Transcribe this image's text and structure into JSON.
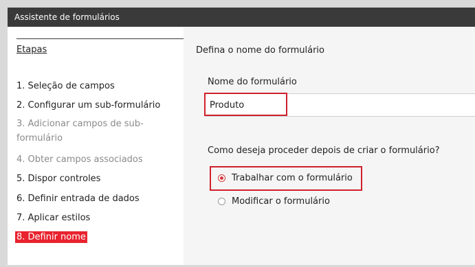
{
  "window": {
    "title": "Assistente de formulários"
  },
  "steps": {
    "heading": "Etapas",
    "items": [
      {
        "label": "1. Seleção de campos",
        "state": "normal"
      },
      {
        "label": "2. Configurar um sub-formulário",
        "state": "normal"
      },
      {
        "label": "3. Adicionar campos de sub-formulário",
        "state": "disabled"
      },
      {
        "label": "4. Obter campos associados",
        "state": "disabled"
      },
      {
        "label": "5. Dispor controles",
        "state": "normal"
      },
      {
        "label": "6. Definir entrada de dados",
        "state": "normal"
      },
      {
        "label": "7. Aplicar estilos",
        "state": "normal"
      },
      {
        "label": "8. Definir nome",
        "state": "current"
      }
    ]
  },
  "main": {
    "title": "Defina o nome do formulário",
    "form_name_label": "Nome do formulário",
    "form_name_value": "Produto",
    "question": "Como deseja proceder depois de criar o formulário?",
    "options": [
      {
        "label": "Trabalhar com o formulário",
        "selected": true
      },
      {
        "label": "Modificar o formulário",
        "selected": false
      }
    ]
  },
  "colors": {
    "accent": "#e8232e",
    "titlebar": "#3a3a3a",
    "right_pane_bg": "#f5f5f5"
  }
}
